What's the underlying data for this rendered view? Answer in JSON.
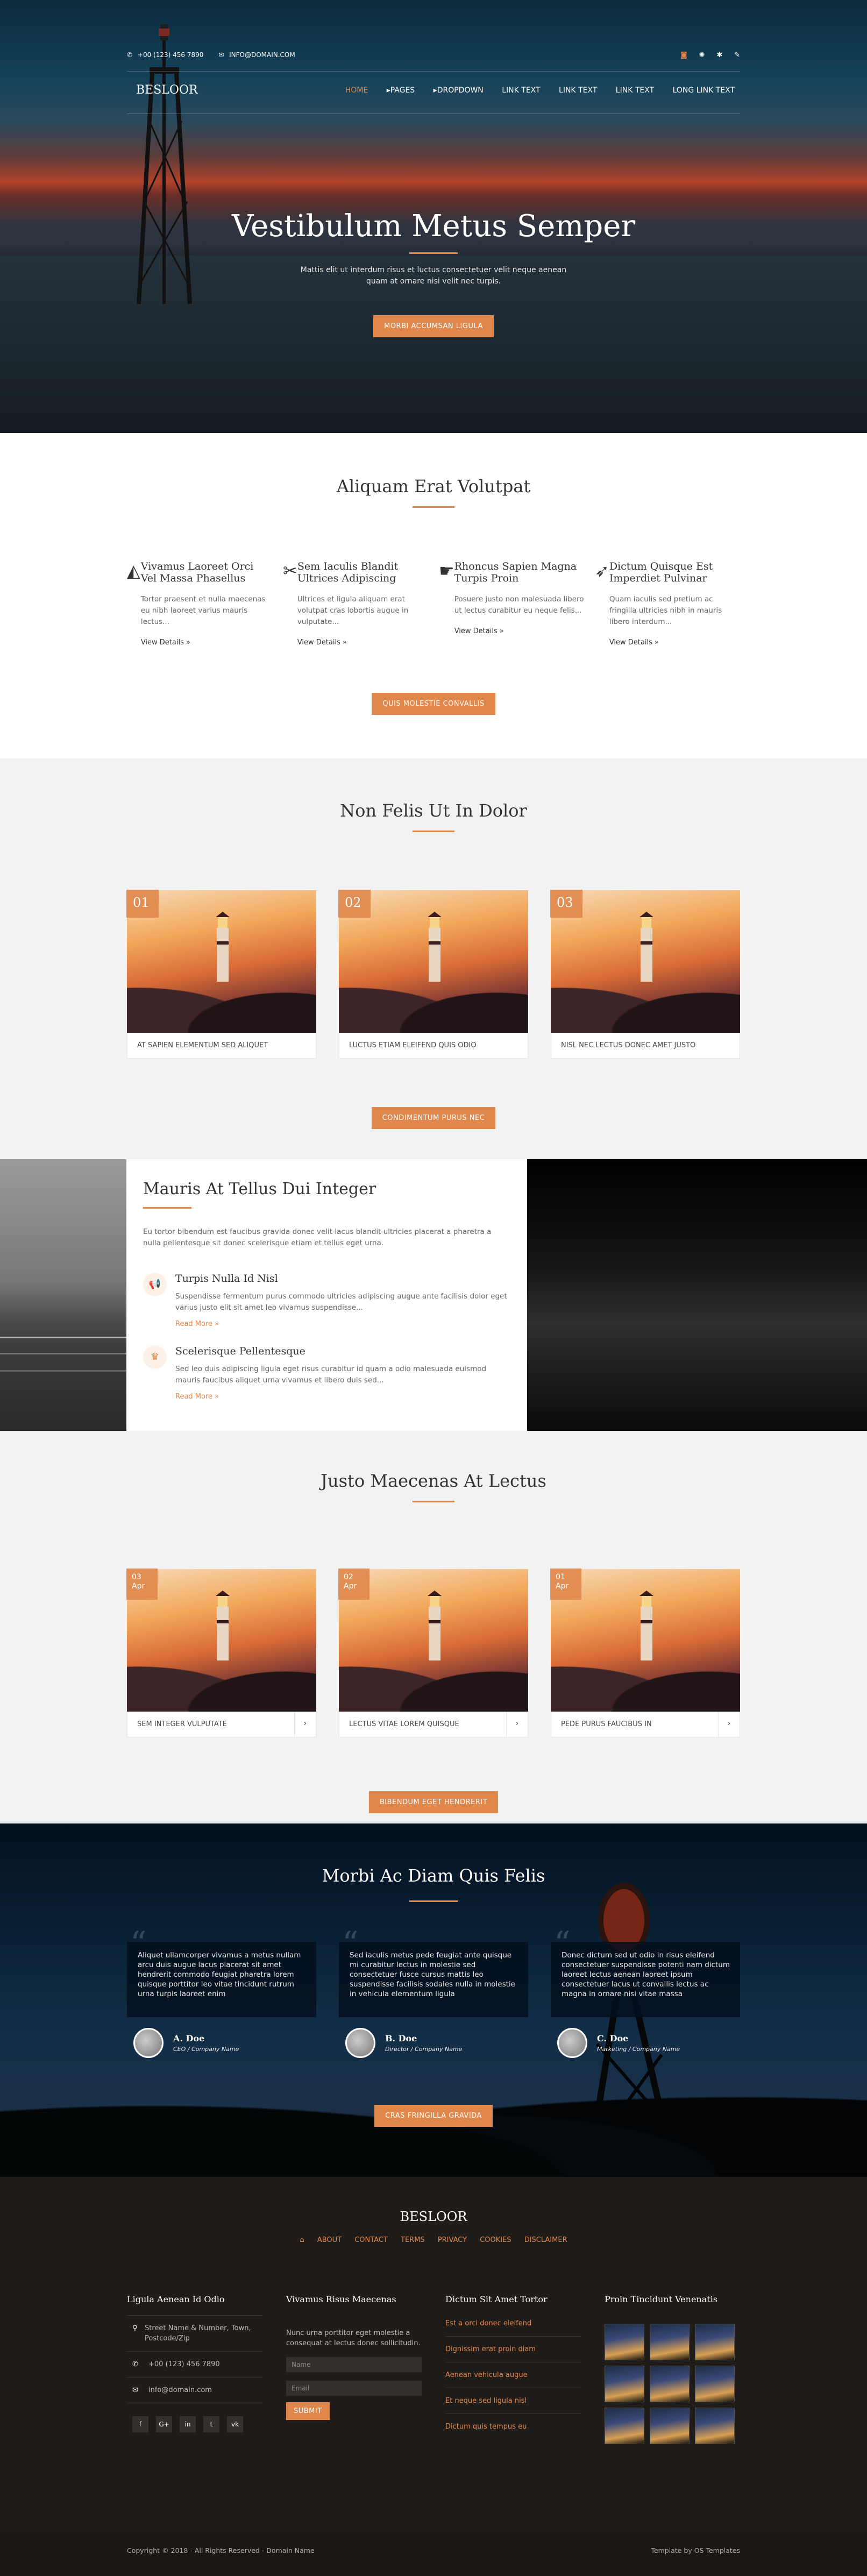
{
  "hero": {
    "phone": "+00 (123) 456 7890",
    "email": "INFO@DOMAIN.COM",
    "logo": "BESLOOR",
    "nav": [
      "HOME",
      "PAGES",
      "DROPDOWN",
      "LINK TEXT",
      "LINK TEXT",
      "LINK TEXT",
      "LONG LINK TEXT"
    ],
    "title": "Vestibulum Metus Semper",
    "text": "Mattis elit ut interdum risus et luctus consectetuer velit neque aenean quam at ornare nisi velit nec turpis.",
    "button": "MORBI ACCUMSAN LIGULA",
    "icons": [
      "rss-icon",
      "dribbble-icon",
      "settings-icon",
      "edit-icon"
    ]
  },
  "features": {
    "title": "Aliquam Erat Volutpat",
    "items": [
      {
        "title": "Vivamus Laoreet Orci Vel Massa Phasellus",
        "text": "Tortor praesent et nulla maecenas eu nibh laoreet varius mauris lectus...",
        "link": "View Details »",
        "icon": "eraser-icon"
      },
      {
        "title": "Sem Iaculis Blandit Ultrices Adipiscing",
        "text": "Ultrices et ligula aliquam erat volutpat cras lobortis augue in vulputate...",
        "link": "View Details »",
        "icon": "scissors-icon"
      },
      {
        "title": "Rhoncus Sapien Magna Turpis Proin",
        "text": "Posuere justo non malesuada libero ut lectus curabitur eu neque felis...",
        "link": "View Details »",
        "icon": "handshake-icon"
      },
      {
        "title": "Dictum Quisque Est Imperdiet Pulvinar",
        "text": "Quam iaculis sed pretium ac fringilla ultricies nibh in mauris libero interdum...",
        "link": "View Details »",
        "icon": "rocket-icon"
      }
    ],
    "button": "QUIS MOLESTIE CONVALLIS"
  },
  "gallery": {
    "title": "Non Felis Ut In Dolor",
    "cards": [
      {
        "num": "01",
        "caption": "AT SAPIEN ELEMENTUM SED ALIQUET"
      },
      {
        "num": "02",
        "caption": "LUCTUS ETIAM ELEIFEND QUIS ODIO"
      },
      {
        "num": "03",
        "caption": "NISL NEC LECTUS DONEC AMET JUSTO"
      }
    ],
    "button": "CONDIMENTUM PURUS NEC"
  },
  "split": {
    "title": "Mauris At Tellus Dui Integer",
    "intro": "Eu tortor bibendum est faucibus gravida donec velit lacus blandit ultricies placerat a pharetra a nulla pellentesque sit donec scelerisque etiam et tellus eget urna.",
    "items": [
      {
        "title": "Turpis Nulla Id Nisl",
        "text": "Suspendisse fermentum purus commodo ultricies adipiscing augue ante facilisis dolor eget varius justo elit sit amet leo vivamus suspendisse...",
        "link": "Read More »",
        "icon": "bullhorn-icon"
      },
      {
        "title": "Scelerisque Pellentesque",
        "text": "Sed leo duis adipiscing ligula eget risus curabitur id quam a odio malesuada euismod mauris faucibus aliquet urna vivamus et libero duis sed...",
        "link": "Read More »",
        "icon": "trophy-icon"
      }
    ]
  },
  "news": {
    "title": "Justo Maecenas At Lectus",
    "cards": [
      {
        "day": "03",
        "month": "Apr",
        "caption": "SEM INTEGER VULPUTATE"
      },
      {
        "day": "02",
        "month": "Apr",
        "caption": "LECTUS VITAE LOREM QUISQUE"
      },
      {
        "day": "01",
        "month": "Apr",
        "caption": "PEDE PURUS FAUCIBUS IN"
      }
    ],
    "button": "BIBENDUM EGET HENDRERIT"
  },
  "testimonials": {
    "title": "Morbi Ac Diam Quis Felis",
    "items": [
      {
        "quote": "Aliquet ullamcorper vivamus a metus nullam arcu duis augue lacus placerat sit amet hendrerit commodo feugiat pharetra lorem quisque porttitor leo vitae tincidunt rutrum urna turpis laoreet enim",
        "name": "A. Doe",
        "role": "CEO / Company Name"
      },
      {
        "quote": "Sed iaculis metus pede feugiat ante quisque mi curabitur lectus in molestie sed consectetuer fusce cursus mattis leo suspendisse facilisis sodales nulla in molestie in vehicula elementum ligula",
        "name": "B. Doe",
        "role": "Director / Company Name"
      },
      {
        "quote": "Donec dictum sed ut odio in risus eleifend consectetuer suspendisse potenti nam dictum laoreet lectus aenean laoreet ipsum consectetuer lacus ut convallis lectus ac magna in ornare nisi vitae massa",
        "name": "C. Doe",
        "role": "Marketing / Company Name"
      }
    ],
    "button": "CRAS FRINGILLA GRAVIDA"
  },
  "footer": {
    "logo": "BESLOOR",
    "links": [
      "ABOUT",
      "CONTACT",
      "TERMS",
      "PRIVACY",
      "COOKIES",
      "DISCLAIMER"
    ],
    "col1": {
      "title": "Ligula Aenean Id Odio",
      "address": "Street Name & Number, Town, Postcode/Zip",
      "phone": "+00 (123) 456 7890",
      "email": "info@domain.com",
      "social": [
        "f",
        "G+",
        "in",
        "t",
        "vk"
      ]
    },
    "col2": {
      "title": "Vivamus Risus Maecenas",
      "text": "Nunc urna porttitor eget molestie a consequat at lectus donec sollicitudin.",
      "name_ph": "Name",
      "email_ph": "Email",
      "button": "SUBMIT"
    },
    "col3": {
      "title": "Dictum Sit Amet Tortor",
      "links": [
        "Est a orci donec eleifend",
        "Dignissim erat proin diam",
        "Aenean vehicula augue",
        "Et neque sed ligula nisl",
        "Dictum quis tempus eu"
      ]
    },
    "col4": {
      "title": "Proin Tincidunt Venenatis"
    },
    "copyright": "Copyright © 2018 - All Rights Reserved - Domain Name",
    "credit": "Template by OS Templates"
  },
  "colors": {
    "accent": "#e0874b",
    "footer_bg": "#201c19",
    "section_bg": "#f2f2f2"
  }
}
